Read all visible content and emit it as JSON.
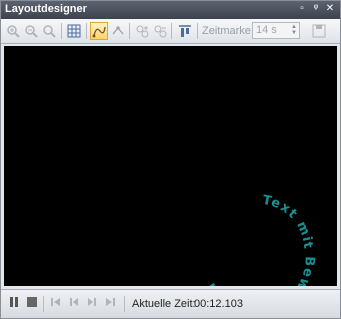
{
  "window": {
    "title": "Layoutdesigner"
  },
  "toolbar": {
    "zeitmarke_label": "Zeitmarke:",
    "zeitmarke_value": "14 s"
  },
  "canvas": {
    "curved_text": "Text mit Bewegungspfad",
    "text_color": "#1a8f91"
  },
  "status": {
    "time_label": "Aktuelle Zeit:",
    "time_value": "00:12.103"
  }
}
